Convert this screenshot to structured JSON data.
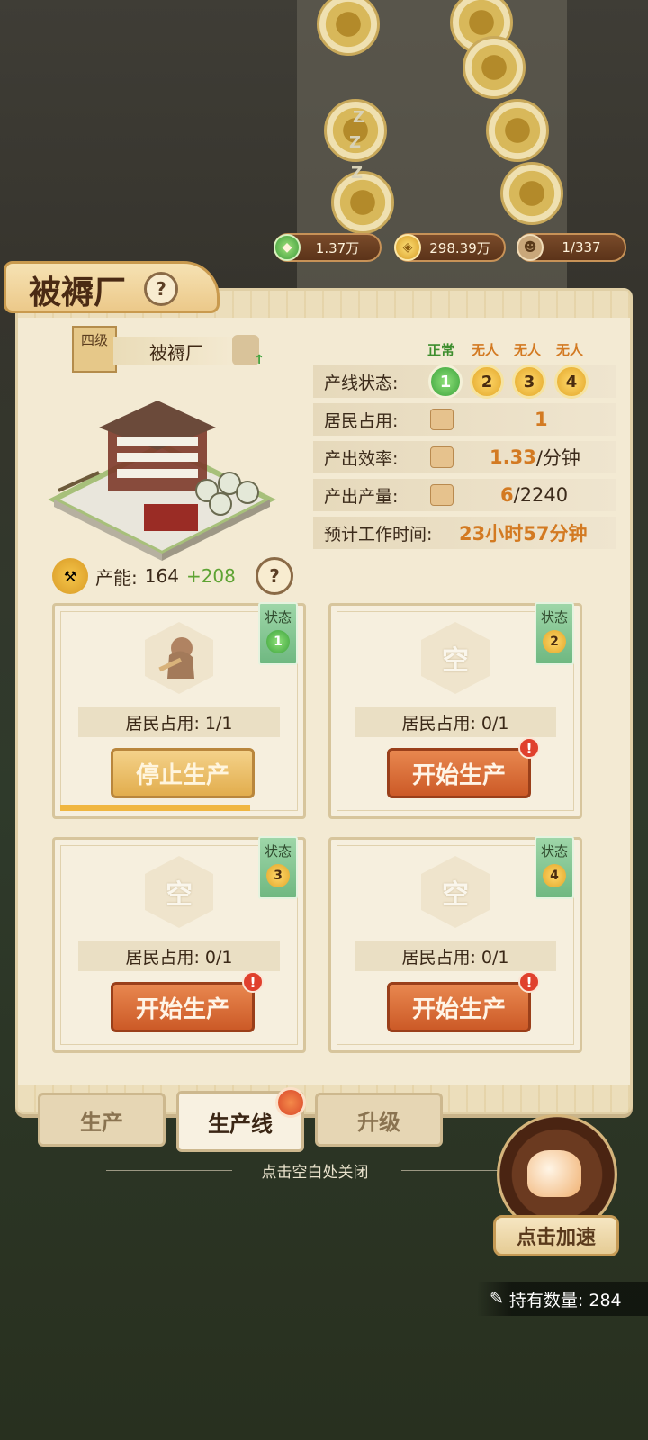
{
  "resources": [
    {
      "icon": "jade-icon",
      "value": "1.37万"
    },
    {
      "icon": "coin-icon",
      "value": "298.39万"
    },
    {
      "icon": "worker-icon",
      "value": "1/337"
    }
  ],
  "title": "被褥厂",
  "building": {
    "level": "四级",
    "name": "被褥厂",
    "capacity_label": "产能:",
    "capacity_value": "164",
    "capacity_bonus": "+208"
  },
  "status_headers": [
    "正常",
    "无人",
    "无人",
    "无人"
  ],
  "stats": {
    "line_status_label": "产线状态:",
    "lanes": [
      "1",
      "2",
      "3",
      "4"
    ],
    "resident_label": "居民占用:",
    "resident_value": "1",
    "efficiency_label": "产出效率:",
    "efficiency_value": "1.33",
    "efficiency_unit": "/分钟",
    "output_label": "产出产量:",
    "output_value": "6",
    "output_total": "/2240",
    "work_time_label": "预计工作时间:",
    "work_time_value": "23小时57分钟"
  },
  "cards": [
    {
      "state_label": "状态",
      "state_num": "1",
      "empty_text": "",
      "occupy": "居民占用: 1/1",
      "button": "停止生产",
      "progress": 0.8
    },
    {
      "state_label": "状态",
      "state_num": "2",
      "empty_text": "空",
      "occupy": "居民占用: 0/1",
      "button": "开始生产"
    },
    {
      "state_label": "状态",
      "state_num": "3",
      "empty_text": "空",
      "occupy": "居民占用: 0/1",
      "button": "开始生产"
    },
    {
      "state_label": "状态",
      "state_num": "4",
      "empty_text": "空",
      "occupy": "居民占用: 0/1",
      "button": "开始生产"
    }
  ],
  "alert_mark": "!",
  "help_mark": "?",
  "tabs": [
    "生产",
    "生产线",
    "升级"
  ],
  "hint": "点击空白处关闭",
  "speed_up": "点击加速",
  "hold_count": "持有数量: 284",
  "colors": {
    "accent_orange": "#d37a22",
    "green": "#5ea333",
    "start_btn": "#cc5a27"
  }
}
